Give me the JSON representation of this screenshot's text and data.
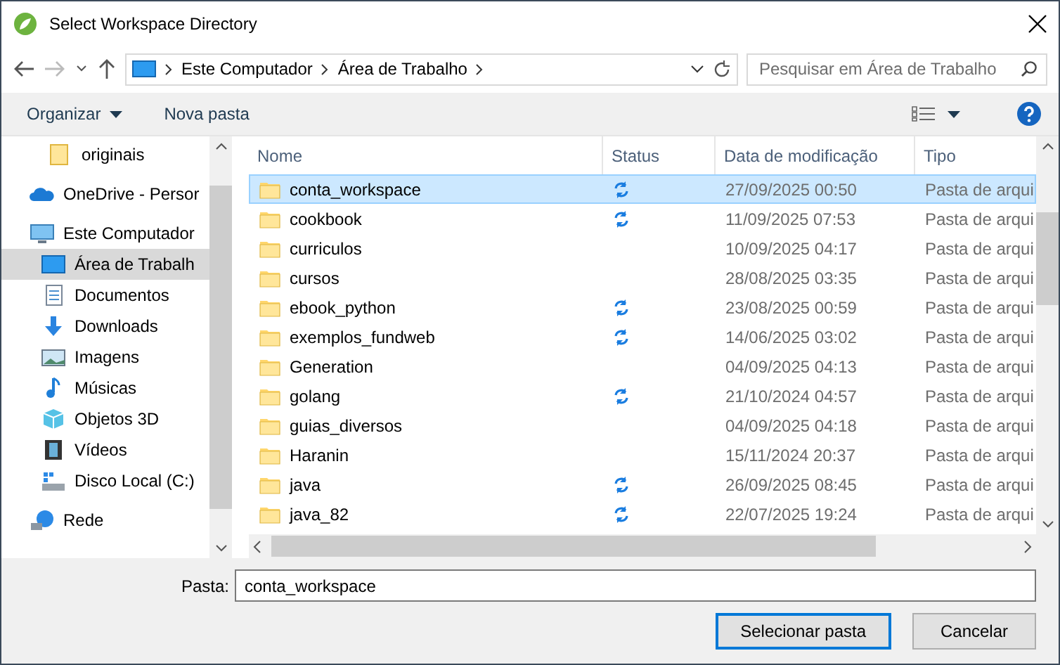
{
  "window": {
    "title": "Select Workspace Directory"
  },
  "address": {
    "crumbs": [
      "Este Computador",
      "Área de Trabalho"
    ],
    "search_placeholder": "Pesquisar em Área de Trabalho"
  },
  "toolbar": {
    "organize": "Organizar",
    "new_folder": "Nova pasta"
  },
  "sidebar": {
    "items": [
      {
        "kind": "folder",
        "label": "originais",
        "selected": false
      },
      {
        "kind": "cloud",
        "label": "OneDrive - Persor",
        "selected": false
      },
      {
        "kind": "computer",
        "label": "Este Computador",
        "selected": false,
        "children": [
          {
            "kind": "desktop",
            "label": "Área de Trabalh",
            "selected": true
          },
          {
            "kind": "documents",
            "label": "Documentos",
            "selected": false
          },
          {
            "kind": "download",
            "label": "Downloads",
            "selected": false
          },
          {
            "kind": "images",
            "label": "Imagens",
            "selected": false
          },
          {
            "kind": "music",
            "label": "Músicas",
            "selected": false
          },
          {
            "kind": "objects3d",
            "label": "Objetos 3D",
            "selected": false
          },
          {
            "kind": "video",
            "label": "Vídeos",
            "selected": false
          },
          {
            "kind": "disk",
            "label": "Disco Local (C:)",
            "selected": false
          }
        ]
      },
      {
        "kind": "network",
        "label": "Rede",
        "selected": false
      }
    ]
  },
  "table": {
    "columns": [
      "Nome",
      "Status",
      "Data de modificação",
      "Tipo"
    ],
    "rows": [
      {
        "name": "conta_workspace",
        "synced": true,
        "date": "27/09/2025 00:50",
        "type": "Pasta de arqui",
        "selected": true
      },
      {
        "name": "cookbook",
        "synced": true,
        "date": "11/09/2025 07:53",
        "type": "Pasta de arqui",
        "selected": false
      },
      {
        "name": "curriculos",
        "synced": false,
        "date": "10/09/2025 04:17",
        "type": "Pasta de arqui",
        "selected": false
      },
      {
        "name": "cursos",
        "synced": false,
        "date": "28/08/2025 03:35",
        "type": "Pasta de arqui",
        "selected": false
      },
      {
        "name": "ebook_python",
        "synced": true,
        "date": "23/08/2025 00:59",
        "type": "Pasta de arqui",
        "selected": false
      },
      {
        "name": "exemplos_fundweb",
        "synced": true,
        "date": "14/06/2025 03:02",
        "type": "Pasta de arqui",
        "selected": false
      },
      {
        "name": "Generation",
        "synced": false,
        "date": "04/09/2025 04:13",
        "type": "Pasta de arqui",
        "selected": false
      },
      {
        "name": "golang",
        "synced": true,
        "date": "21/10/2024 04:57",
        "type": "Pasta de arqui",
        "selected": false
      },
      {
        "name": "guias_diversos",
        "synced": false,
        "date": "04/09/2025 04:18",
        "type": "Pasta de arqui",
        "selected": false
      },
      {
        "name": "Haranin",
        "synced": false,
        "date": "15/11/2024 20:37",
        "type": "Pasta de arqui",
        "selected": false
      },
      {
        "name": "java",
        "synced": true,
        "date": "26/09/2025 08:45",
        "type": "Pasta de arqui",
        "selected": false
      },
      {
        "name": "java_82",
        "synced": true,
        "date": "22/07/2025 19:24",
        "type": "Pasta de arqui",
        "selected": false
      }
    ]
  },
  "folder_field": {
    "label": "Pasta:",
    "value": "conta_workspace"
  },
  "buttons": [
    {
      "label": "Selecionar pasta",
      "kind": "primary"
    },
    {
      "label": "Cancelar",
      "kind": "secondary"
    }
  ]
}
